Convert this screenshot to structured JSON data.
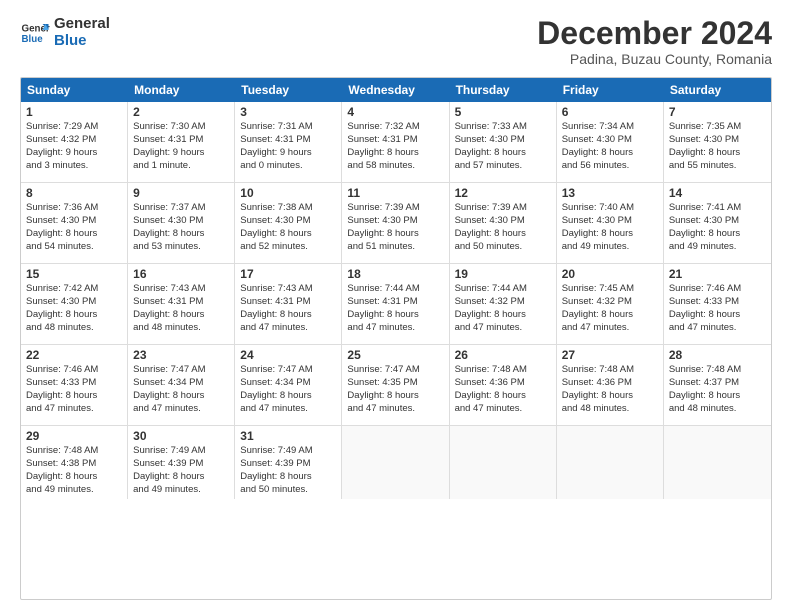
{
  "logo": {
    "line1": "General",
    "line2": "Blue"
  },
  "title": "December 2024",
  "subtitle": "Padina, Buzau County, Romania",
  "header_days": [
    "Sunday",
    "Monday",
    "Tuesday",
    "Wednesday",
    "Thursday",
    "Friday",
    "Saturday"
  ],
  "weeks": [
    [
      {
        "day": 1,
        "lines": [
          "Sunrise: 7:29 AM",
          "Sunset: 4:32 PM",
          "Daylight: 9 hours",
          "and 3 minutes."
        ]
      },
      {
        "day": 2,
        "lines": [
          "Sunrise: 7:30 AM",
          "Sunset: 4:31 PM",
          "Daylight: 9 hours",
          "and 1 minute."
        ]
      },
      {
        "day": 3,
        "lines": [
          "Sunrise: 7:31 AM",
          "Sunset: 4:31 PM",
          "Daylight: 9 hours",
          "and 0 minutes."
        ]
      },
      {
        "day": 4,
        "lines": [
          "Sunrise: 7:32 AM",
          "Sunset: 4:31 PM",
          "Daylight: 8 hours",
          "and 58 minutes."
        ]
      },
      {
        "day": 5,
        "lines": [
          "Sunrise: 7:33 AM",
          "Sunset: 4:30 PM",
          "Daylight: 8 hours",
          "and 57 minutes."
        ]
      },
      {
        "day": 6,
        "lines": [
          "Sunrise: 7:34 AM",
          "Sunset: 4:30 PM",
          "Daylight: 8 hours",
          "and 56 minutes."
        ]
      },
      {
        "day": 7,
        "lines": [
          "Sunrise: 7:35 AM",
          "Sunset: 4:30 PM",
          "Daylight: 8 hours",
          "and 55 minutes."
        ]
      }
    ],
    [
      {
        "day": 8,
        "lines": [
          "Sunrise: 7:36 AM",
          "Sunset: 4:30 PM",
          "Daylight: 8 hours",
          "and 54 minutes."
        ]
      },
      {
        "day": 9,
        "lines": [
          "Sunrise: 7:37 AM",
          "Sunset: 4:30 PM",
          "Daylight: 8 hours",
          "and 53 minutes."
        ]
      },
      {
        "day": 10,
        "lines": [
          "Sunrise: 7:38 AM",
          "Sunset: 4:30 PM",
          "Daylight: 8 hours",
          "and 52 minutes."
        ]
      },
      {
        "day": 11,
        "lines": [
          "Sunrise: 7:39 AM",
          "Sunset: 4:30 PM",
          "Daylight: 8 hours",
          "and 51 minutes."
        ]
      },
      {
        "day": 12,
        "lines": [
          "Sunrise: 7:39 AM",
          "Sunset: 4:30 PM",
          "Daylight: 8 hours",
          "and 50 minutes."
        ]
      },
      {
        "day": 13,
        "lines": [
          "Sunrise: 7:40 AM",
          "Sunset: 4:30 PM",
          "Daylight: 8 hours",
          "and 49 minutes."
        ]
      },
      {
        "day": 14,
        "lines": [
          "Sunrise: 7:41 AM",
          "Sunset: 4:30 PM",
          "Daylight: 8 hours",
          "and 49 minutes."
        ]
      }
    ],
    [
      {
        "day": 15,
        "lines": [
          "Sunrise: 7:42 AM",
          "Sunset: 4:30 PM",
          "Daylight: 8 hours",
          "and 48 minutes."
        ]
      },
      {
        "day": 16,
        "lines": [
          "Sunrise: 7:43 AM",
          "Sunset: 4:31 PM",
          "Daylight: 8 hours",
          "and 48 minutes."
        ]
      },
      {
        "day": 17,
        "lines": [
          "Sunrise: 7:43 AM",
          "Sunset: 4:31 PM",
          "Daylight: 8 hours",
          "and 47 minutes."
        ]
      },
      {
        "day": 18,
        "lines": [
          "Sunrise: 7:44 AM",
          "Sunset: 4:31 PM",
          "Daylight: 8 hours",
          "and 47 minutes."
        ]
      },
      {
        "day": 19,
        "lines": [
          "Sunrise: 7:44 AM",
          "Sunset: 4:32 PM",
          "Daylight: 8 hours",
          "and 47 minutes."
        ]
      },
      {
        "day": 20,
        "lines": [
          "Sunrise: 7:45 AM",
          "Sunset: 4:32 PM",
          "Daylight: 8 hours",
          "and 47 minutes."
        ]
      },
      {
        "day": 21,
        "lines": [
          "Sunrise: 7:46 AM",
          "Sunset: 4:33 PM",
          "Daylight: 8 hours",
          "and 47 minutes."
        ]
      }
    ],
    [
      {
        "day": 22,
        "lines": [
          "Sunrise: 7:46 AM",
          "Sunset: 4:33 PM",
          "Daylight: 8 hours",
          "and 47 minutes."
        ]
      },
      {
        "day": 23,
        "lines": [
          "Sunrise: 7:47 AM",
          "Sunset: 4:34 PM",
          "Daylight: 8 hours",
          "and 47 minutes."
        ]
      },
      {
        "day": 24,
        "lines": [
          "Sunrise: 7:47 AM",
          "Sunset: 4:34 PM",
          "Daylight: 8 hours",
          "and 47 minutes."
        ]
      },
      {
        "day": 25,
        "lines": [
          "Sunrise: 7:47 AM",
          "Sunset: 4:35 PM",
          "Daylight: 8 hours",
          "and 47 minutes."
        ]
      },
      {
        "day": 26,
        "lines": [
          "Sunrise: 7:48 AM",
          "Sunset: 4:36 PM",
          "Daylight: 8 hours",
          "and 47 minutes."
        ]
      },
      {
        "day": 27,
        "lines": [
          "Sunrise: 7:48 AM",
          "Sunset: 4:36 PM",
          "Daylight: 8 hours",
          "and 48 minutes."
        ]
      },
      {
        "day": 28,
        "lines": [
          "Sunrise: 7:48 AM",
          "Sunset: 4:37 PM",
          "Daylight: 8 hours",
          "and 48 minutes."
        ]
      }
    ],
    [
      {
        "day": 29,
        "lines": [
          "Sunrise: 7:48 AM",
          "Sunset: 4:38 PM",
          "Daylight: 8 hours",
          "and 49 minutes."
        ]
      },
      {
        "day": 30,
        "lines": [
          "Sunrise: 7:49 AM",
          "Sunset: 4:39 PM",
          "Daylight: 8 hours",
          "and 49 minutes."
        ]
      },
      {
        "day": 31,
        "lines": [
          "Sunrise: 7:49 AM",
          "Sunset: 4:39 PM",
          "Daylight: 8 hours",
          "and 50 minutes."
        ]
      },
      null,
      null,
      null,
      null
    ]
  ]
}
